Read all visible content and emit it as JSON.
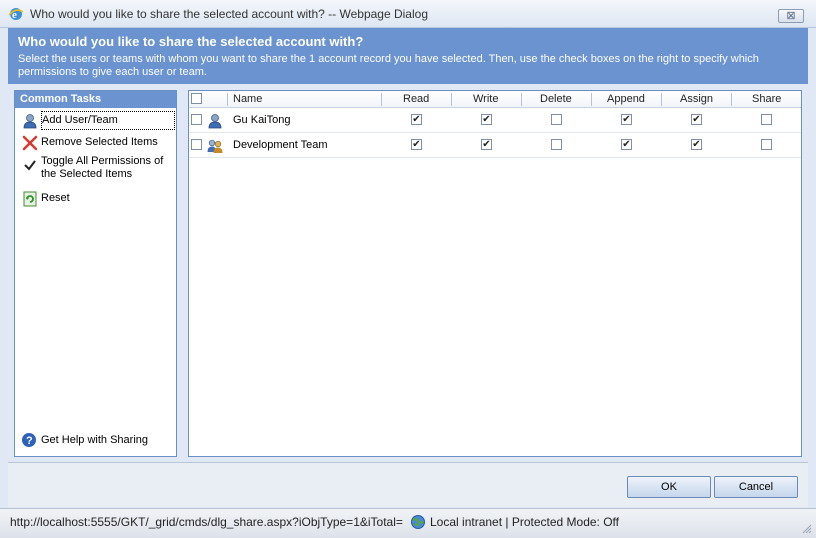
{
  "window": {
    "title": "Who would you like to share the selected account with? -- Webpage Dialog",
    "close_label": "⊠"
  },
  "banner": {
    "heading": "Who would you like to share the selected account with?",
    "description": "Select the users or teams with whom you want to share the 1 account record you have selected. Then, use the check boxes on the right to specify which permissions to give each user or team."
  },
  "tasks": {
    "header": "Common Tasks",
    "items": [
      {
        "label": "Add User/Team",
        "icon": "user-icon"
      },
      {
        "label": "Remove Selected Items",
        "icon": "red-x-icon"
      },
      {
        "label": "Toggle All Permissions of the Selected Items",
        "icon": "checkmark-icon"
      },
      {
        "label": "Reset",
        "icon": "reset-icon"
      }
    ],
    "help_label": "Get Help with Sharing"
  },
  "grid": {
    "columns": [
      "Name",
      "Read",
      "Write",
      "Delete",
      "Append",
      "Assign",
      "Share"
    ],
    "rows": [
      {
        "name": "Gu KaiTong",
        "type": "user",
        "selected": false,
        "perms": [
          true,
          true,
          false,
          true,
          true,
          false
        ]
      },
      {
        "name": "Development Team",
        "type": "team",
        "selected": false,
        "perms": [
          true,
          true,
          false,
          true,
          true,
          false
        ]
      }
    ]
  },
  "buttons": {
    "ok": "OK",
    "cancel": "Cancel"
  },
  "statusbar": {
    "url": "http://localhost:5555/GKT/_grid/cmds/dlg_share.aspx?iObjType=1&iTotal=",
    "zone": "Local intranet | Protected Mode: Off"
  },
  "colors": {
    "banner": "#6a93d0",
    "border": "#6b8fc2",
    "background": "#dfe8f4"
  }
}
